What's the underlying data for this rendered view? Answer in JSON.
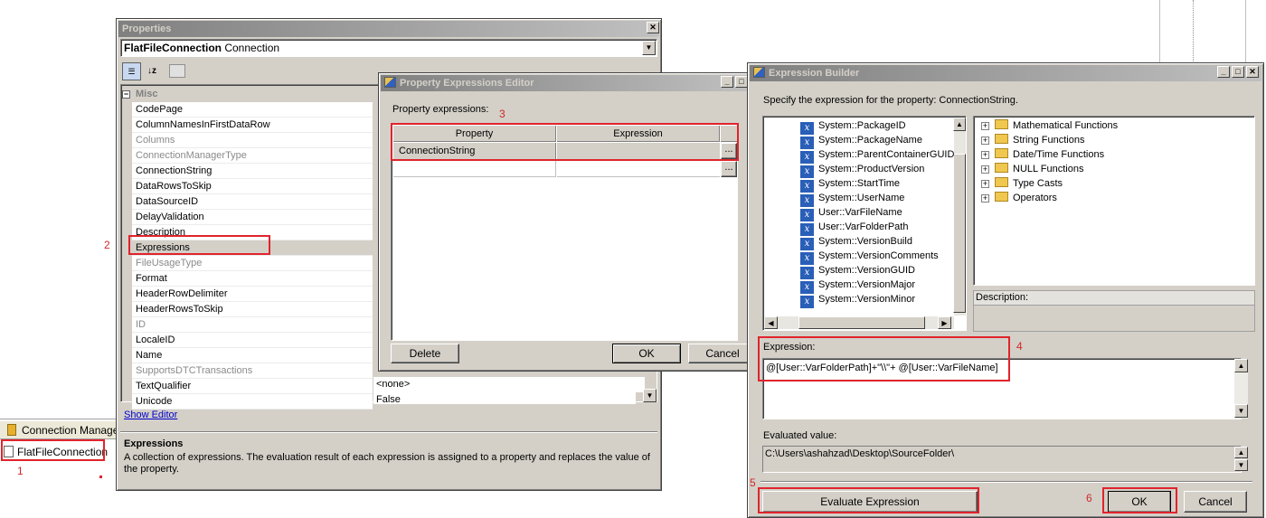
{
  "properties": {
    "title": "Properties",
    "object_name": "FlatFileConnection",
    "object_type": "Connection",
    "category": "Misc",
    "rows": [
      {
        "name": "CodePage",
        "dim": false
      },
      {
        "name": "ColumnNamesInFirstDataRow",
        "dim": false
      },
      {
        "name": "Columns",
        "dim": true
      },
      {
        "name": "ConnectionManagerType",
        "dim": true
      },
      {
        "name": "ConnectionString",
        "dim": false
      },
      {
        "name": "DataRowsToSkip",
        "dim": false
      },
      {
        "name": "DataSourceID",
        "dim": false
      },
      {
        "name": "DelayValidation",
        "dim": false
      },
      {
        "name": "Description",
        "dim": false
      },
      {
        "name": "Expressions",
        "dim": false
      },
      {
        "name": "FileUsageType",
        "dim": true
      },
      {
        "name": "Format",
        "dim": false
      },
      {
        "name": "HeaderRowDelimiter",
        "dim": false
      },
      {
        "name": "HeaderRowsToSkip",
        "dim": false
      },
      {
        "name": "ID",
        "dim": true
      },
      {
        "name": "LocaleID",
        "dim": false
      },
      {
        "name": "Name",
        "dim": false
      },
      {
        "name": "SupportsDTCTransactions",
        "dim": true
      },
      {
        "name": "TextQualifier",
        "dim": false
      },
      {
        "name": "Unicode",
        "dim": false
      }
    ],
    "text_qualifier_value": "<none>",
    "unicode_value": "False",
    "show_editor": "Show Editor",
    "desc_title": "Expressions",
    "desc_text": "A collection of expressions. The evaluation result of each expression is assigned to a property and replaces the value of the property."
  },
  "connection_manager": {
    "tab_label": "Connection Manager",
    "item": "FlatFileConnection"
  },
  "pee": {
    "title": "Property Expressions Editor",
    "label": "Property expressions:",
    "col_property": "Property",
    "col_expression": "Expression",
    "row_property": "ConnectionString",
    "ellipsis": "...",
    "delete": "Delete",
    "ok": "OK",
    "cancel": "Cancel"
  },
  "eb": {
    "title": "Expression Builder",
    "instruction": "Specify the expression for the property: ConnectionString.",
    "variables": [
      "System::PackageID",
      "System::PackageName",
      "System::ParentContainerGUID",
      "System::ProductVersion",
      "System::StartTime",
      "System::UserName",
      "User::VarFileName",
      "User::VarFolderPath",
      "System::VersionBuild",
      "System::VersionComments",
      "System::VersionGUID",
      "System::VersionMajor",
      "System::VersionMinor"
    ],
    "functions": [
      "Mathematical Functions",
      "String Functions",
      "Date/Time Functions",
      "NULL Functions",
      "Type Casts",
      "Operators"
    ],
    "description_label": "Description:",
    "expression_label": "Expression:",
    "expression_value": "@[User::VarFolderPath]+\"\\\\\"+ @[User::VarFileName]",
    "evaluated_label": "Evaluated value:",
    "evaluated_value": "C:\\Users\\ashahzad\\Desktop\\SourceFolder\\",
    "evaluate_button": "Evaluate Expression",
    "ok": "OK",
    "cancel": "Cancel"
  },
  "steps": [
    "1",
    "2",
    "3",
    "4",
    "5",
    "6"
  ],
  "colors": {
    "annotation_red": "#e0242c",
    "dialog_face": "#d4d0c8",
    "variable_icon": "#2a5fb8"
  }
}
